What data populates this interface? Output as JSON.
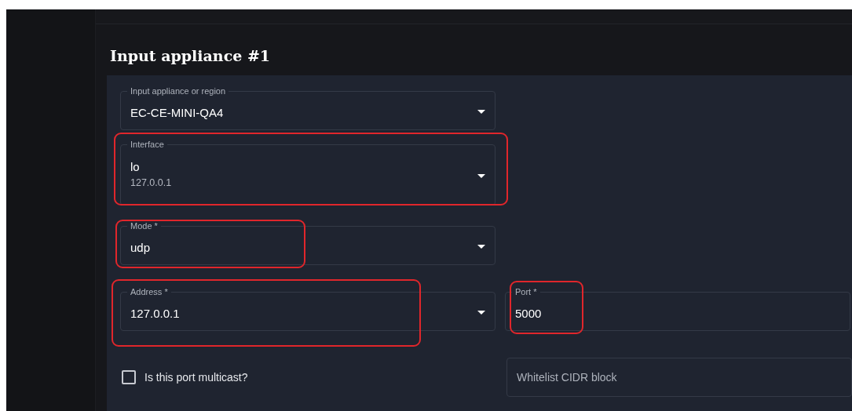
{
  "section": {
    "title": "Input appliance #1"
  },
  "fields": [
    {
      "kind": "select",
      "label": "Input appliance or region",
      "value": "EC-CE-MINI-QA4",
      "highlighted": false
    },
    {
      "kind": "select",
      "label": "Interface",
      "value": "lo",
      "secondary": "127.0.0.1",
      "highlighted": true
    },
    {
      "kind": "select",
      "label": "Mode *",
      "value": "udp",
      "highlighted": true
    },
    {
      "kind": "select",
      "label": "Address *",
      "value": "127.0.0.1",
      "highlighted": true
    },
    {
      "kind": "text",
      "label": "Port *",
      "value": "5000",
      "highlighted": true
    }
  ],
  "multicast": {
    "label": "Is this port multicast?",
    "checked": false
  },
  "whitelist": {
    "placeholder": "Whitelist CIDR block"
  }
}
